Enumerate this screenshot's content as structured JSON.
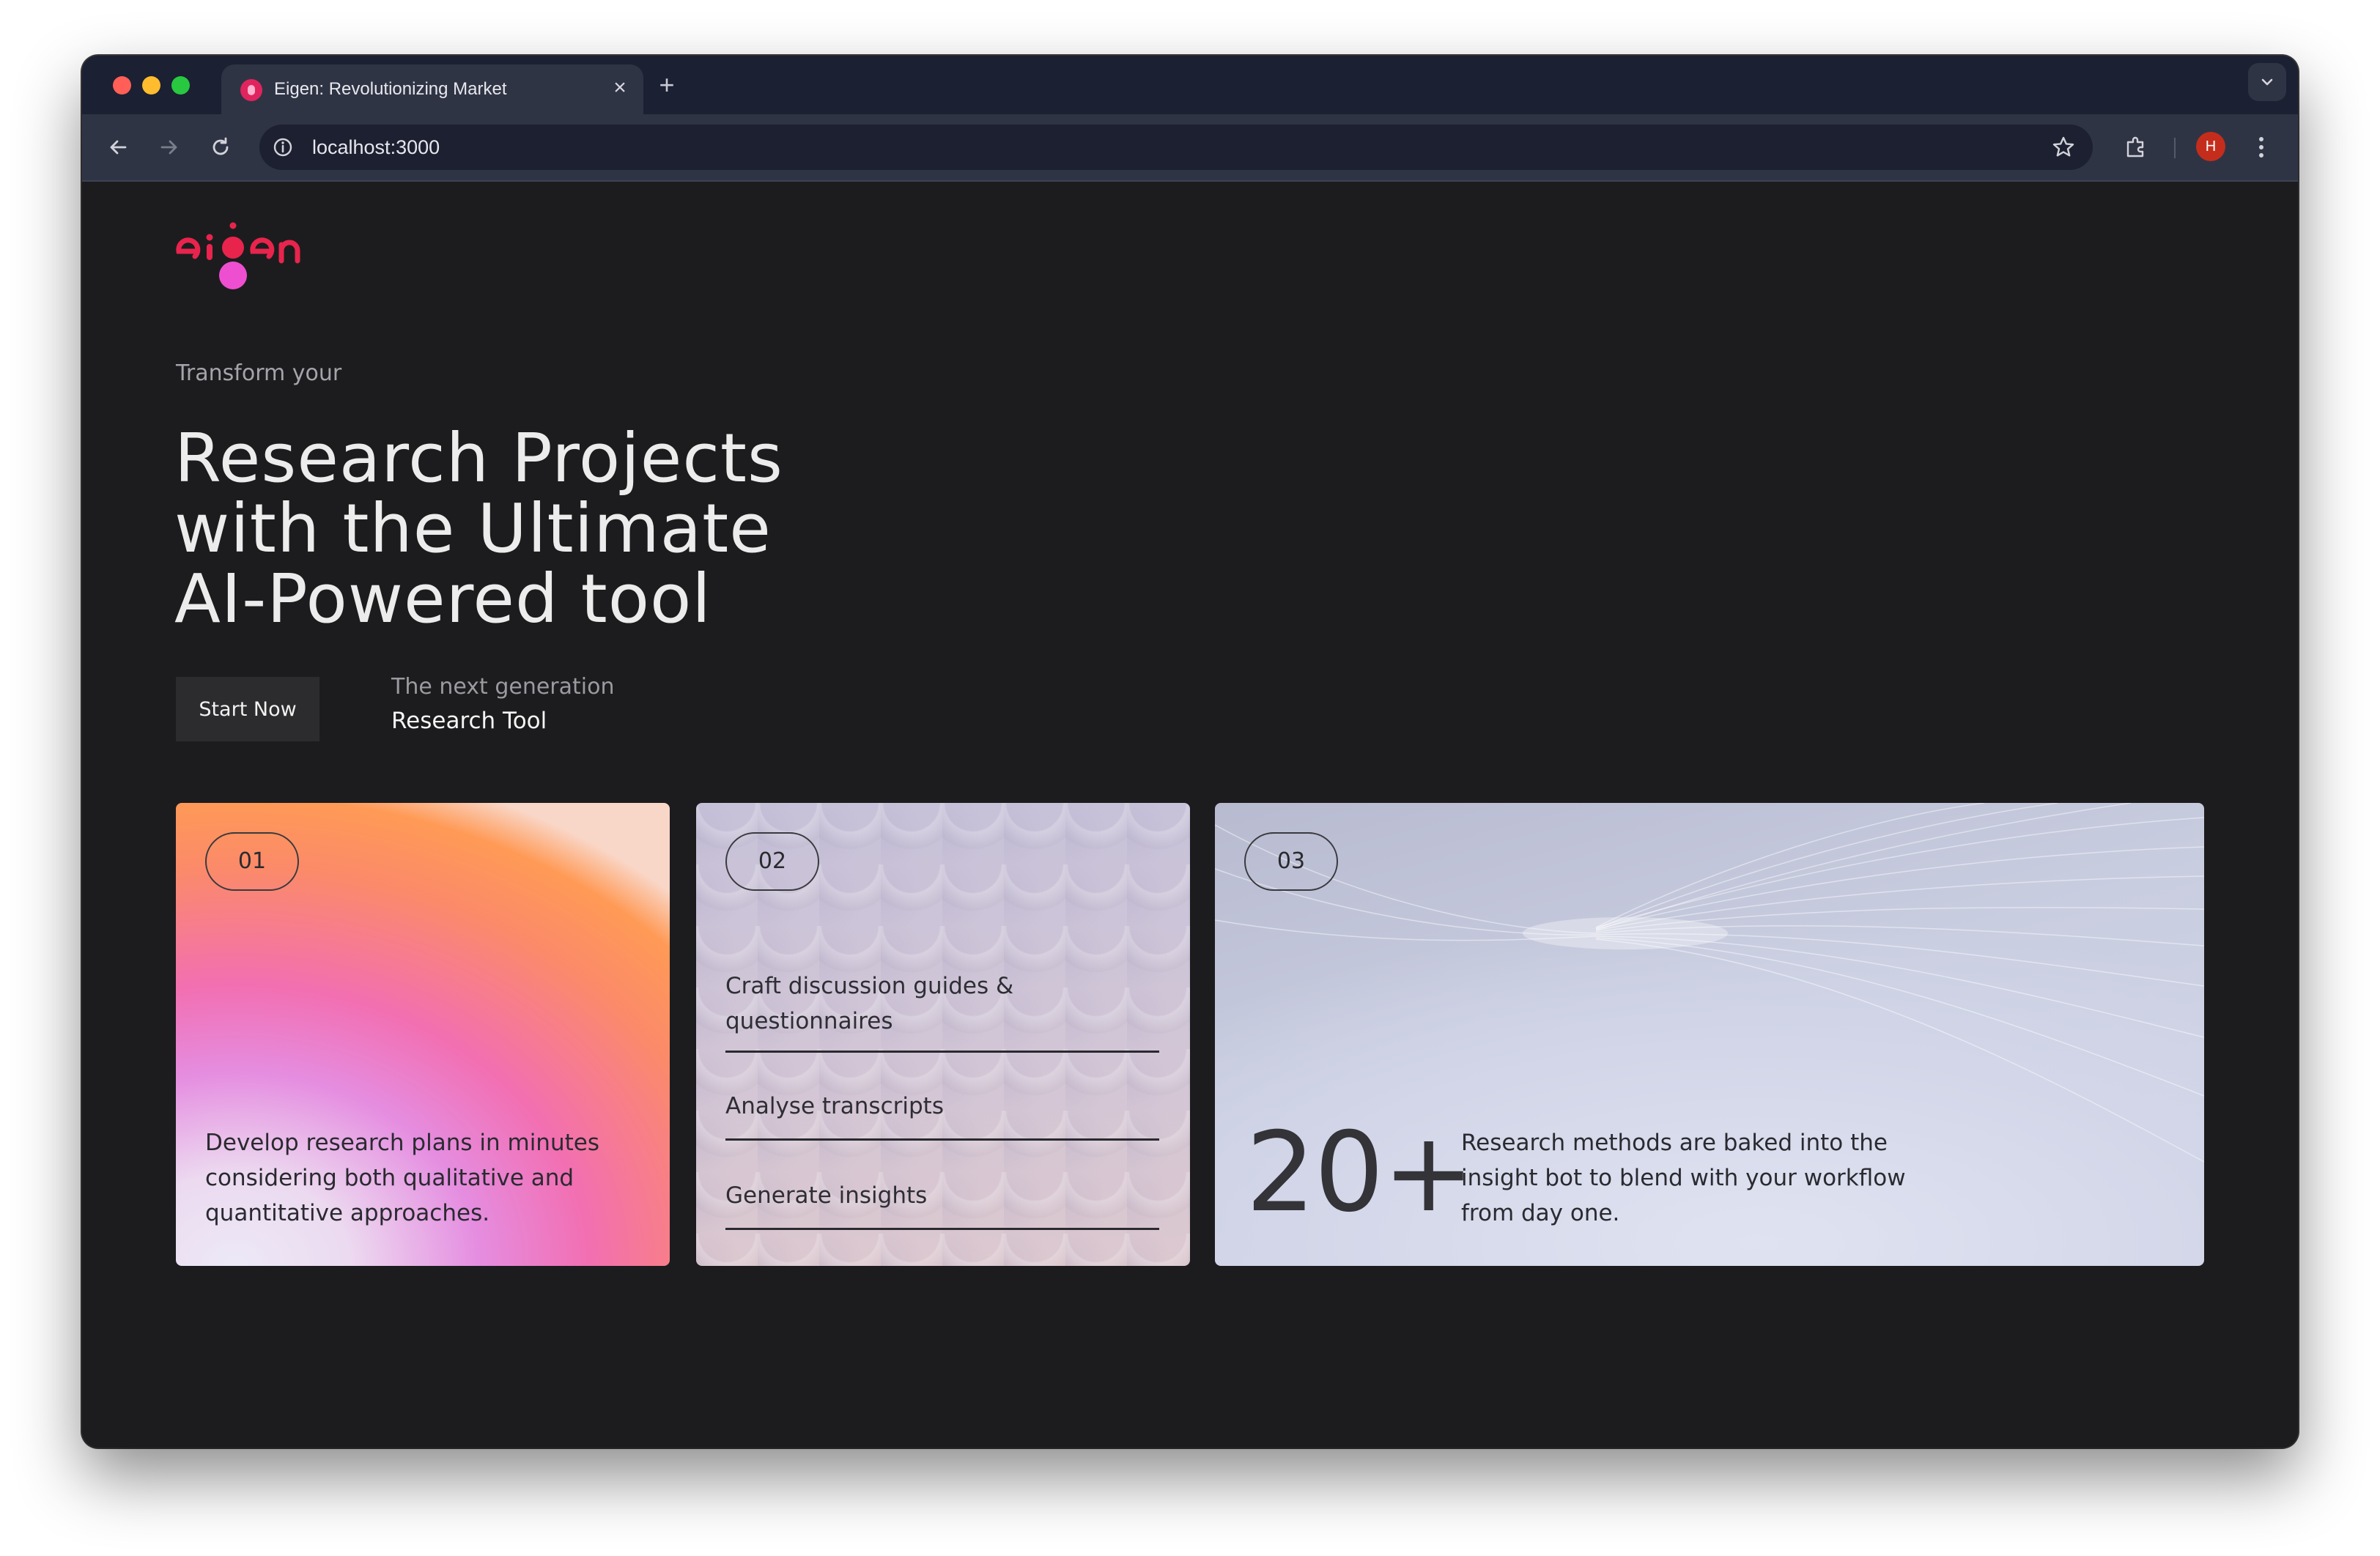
{
  "browser": {
    "tab_title": "Eigen: Revolutionizing Market",
    "url": "localhost:3000",
    "profile_initial": "H"
  },
  "brand": {
    "logo_text": "eigen",
    "primary_color": "#e8244d",
    "accent_color": "#ee4fd0"
  },
  "hero": {
    "eyebrow": "Transform your",
    "headline_lines": [
      "Research Projects",
      "with the Ultimate",
      "AI-Powered tool"
    ],
    "cta_label": "Start Now",
    "tagline_line1": "The next generation",
    "tagline_line2": "Research Tool"
  },
  "cards": [
    {
      "number": "01",
      "text": "Develop research plans in minutes considering both qualitative and quantitative approaches."
    },
    {
      "number": "02",
      "items": [
        "Craft discussion guides & questionnaires",
        "Analyse transcripts",
        "Generate insights"
      ]
    },
    {
      "number": "03",
      "stat": "20+",
      "text": "Research methods are baked into the insight bot to blend with your workflow from day one."
    }
  ]
}
